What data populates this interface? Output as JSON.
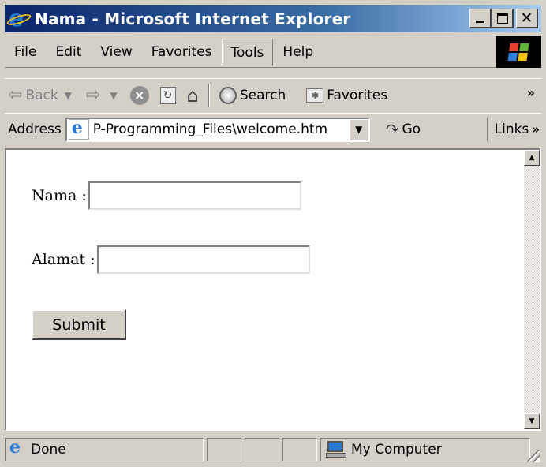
{
  "window": {
    "title": "Nama - Microsoft Internet Explorer"
  },
  "menu": {
    "items": [
      "File",
      "Edit",
      "View",
      "Favorites",
      "Tools",
      "Help"
    ]
  },
  "toolbar": {
    "back_label": "Back",
    "search_label": "Search",
    "favorites_label": "Favorites",
    "overflow": "»"
  },
  "address": {
    "label": "Address",
    "url": "P-Programming_Files\\welcome.htm",
    "go_label": "Go",
    "links_label": "Links",
    "links_overflow": "»"
  },
  "form": {
    "nama_label": "Nama :",
    "nama_value": "",
    "alamat_label": "Alamat :",
    "alamat_value": "",
    "submit_label": "Submit"
  },
  "status": {
    "text": "Done",
    "zone": "My Computer"
  },
  "colors": {
    "titlebar_start": "#0a246a",
    "titlebar_end": "#a6caf0",
    "chrome": "#d4d0c8"
  }
}
